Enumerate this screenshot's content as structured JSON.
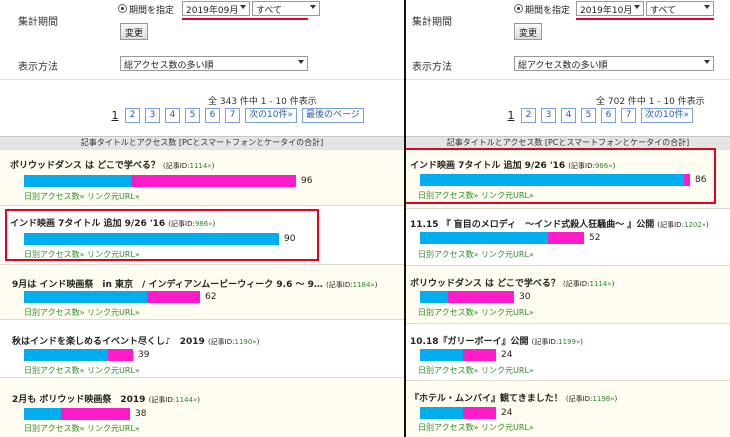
{
  "left": {
    "period_label": "集計期間",
    "radio_label": "期間を指定",
    "month_value": "2019年09月",
    "scope_value": "すべて",
    "change_button": "変更",
    "display_label": "表示方法",
    "display_value": "総アクセス数の多い順",
    "summary": "全 343 件中 1 - 10 件表示",
    "pages": [
      "2",
      "3",
      "4",
      "5",
      "6",
      "7"
    ],
    "current_page": "1",
    "next_label": "次の10件»",
    "last_label": "最後のページ",
    "table_header": "記事タイトルとアクセス数 [PCとスマートフォンとケータイの合計]",
    "articles": [
      {
        "title": "ボリウッドダンス は どこで学べる？",
        "id_prefix": "(記事ID:",
        "id_num": "1114»",
        "id_suffix": ")",
        "count": "96",
        "blue": 0.395,
        "pink": 0.605,
        "links": "日別アクセス数»  リンク元URL»"
      },
      {
        "title": "インド映画 7タイトル 追加 9/26 '16",
        "id_prefix": "(記事ID:",
        "id_num": "986»",
        "id_suffix": ")",
        "count": "90",
        "blue": 1.0,
        "pink": 0.0,
        "links": "日別アクセス数»  リンク元URL»"
      },
      {
        "title": "9月は インド映画祭　in 東京　/ インディアンムービーウィーク 9.6 ～ 9…",
        "id_prefix": "(記事ID:",
        "id_num": "1184»",
        "id_suffix": ")",
        "count": "62",
        "blue": 0.7,
        "pink": 0.3,
        "links": "日別アクセス数»  リンク元URL»"
      },
      {
        "title": "秋はインドを楽しめるイベント尽くし♪　2019",
        "id_prefix": "(記事ID:",
        "id_num": "1190»",
        "id_suffix": ")",
        "count": "39",
        "blue": 0.77,
        "pink": 0.23,
        "links": "日別アクセス数»  リンク元URL»"
      },
      {
        "title": "2月も ボリウッド映画祭　2019",
        "id_prefix": "(記事ID:",
        "id_num": "1144»",
        "id_suffix": ")",
        "count": "38",
        "blue": 0.35,
        "pink": 0.65,
        "links": "日別アクセス数»  リンク元URL»"
      }
    ]
  },
  "right": {
    "period_label": "集計期間",
    "radio_label": "期間を指定",
    "month_value": "2019年10月",
    "scope_value": "すべて",
    "change_button": "変更",
    "display_label": "表示方法",
    "display_value": "総アクセス数の多い順",
    "summary": "全 702 件中 1 - 10 件表示",
    "pages": [
      "2",
      "3",
      "4",
      "5",
      "6",
      "7"
    ],
    "current_page": "1",
    "next_label": "次の10件»",
    "table_header": "記事タイトルとアクセス数 [PCとスマートフォンとケータイの合計]",
    "articles": [
      {
        "title": "インド映画 7タイトル 追加 9/26 '16",
        "id_prefix": "(記事ID:",
        "id_num": "986»",
        "id_suffix": ")",
        "count": "86",
        "blue": 0.976,
        "pink": 0.024,
        "links": "日別アクセス数»  リンク元URL»"
      },
      {
        "title": "11.15 『 盲目のメロディ　～インド式殺人狂騒曲～ 』公開",
        "id_prefix": "(記事ID:",
        "id_num": "1202»",
        "id_suffix": ")",
        "count": "52",
        "blue": 0.78,
        "pink": 0.22,
        "links": "日別アクセス数»  リンク元URL»"
      },
      {
        "title": "ボリウッドダンス は どこで学べる？",
        "id_prefix": "(記事ID:",
        "id_num": "1114»",
        "id_suffix": ")",
        "count": "30",
        "blue": 0.3,
        "pink": 0.7,
        "links": "日別アクセス数»  リンク元URL»"
      },
      {
        "title": "10.18『ガリーボーイ』公開",
        "id_prefix": "(記事ID:",
        "id_num": "1199»",
        "id_suffix": ")",
        "count": "24",
        "blue": 0.56,
        "pink": 0.44,
        "links": "日別アクセス数»  リンク元URL»"
      },
      {
        "title": "『ホテル・ムンバイ』観てきました！",
        "id_prefix": "(記事ID:",
        "id_num": "1198»",
        "id_suffix": ")",
        "count": "24",
        "blue": 0.56,
        "pink": 0.44,
        "links": "日別アクセス数»  リンク元URL»"
      }
    ]
  },
  "colors": {
    "pc": "#00adee",
    "smartphone": "#ff1cc8",
    "highlight": "#e8001e",
    "link": "#2a8a2a"
  }
}
